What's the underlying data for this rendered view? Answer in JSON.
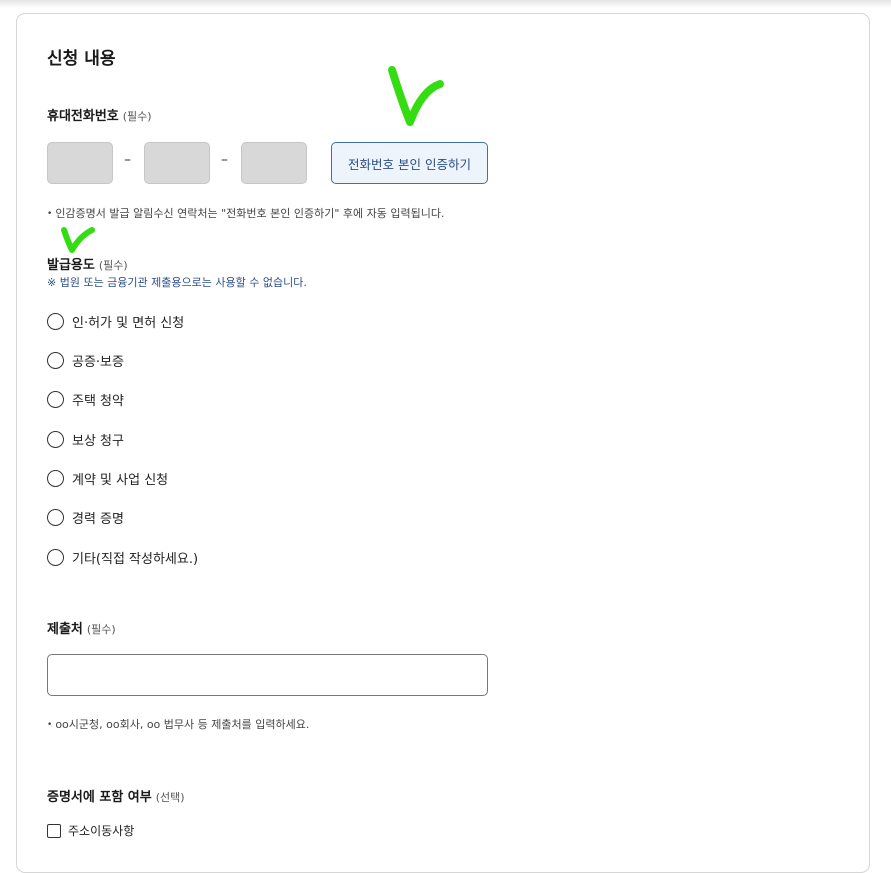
{
  "section": {
    "title": "신청 내용"
  },
  "phone": {
    "label": "휴대전화번호",
    "required": "(필수)",
    "dash": "–",
    "verify_label": "전화번호 본인 인증하기",
    "note": "인감증명서 발급 알림수신 연락처는 \"전화번호 본인 인증하기\" 후에 자동 입력됩니다."
  },
  "purpose": {
    "label": "발급용도",
    "required": "(필수)",
    "warning": "※ 법원 또는 금융기관 제출용으로는 사용할 수 없습니다.",
    "options": [
      "인·허가 및 면허 신청",
      "공증·보증",
      "주택 청약",
      "보상 청구",
      "계약 및 사업 신청",
      "경력 증명",
      "기타(직접 작성하세요.)"
    ]
  },
  "recipient": {
    "label": "제출처",
    "required": "(필수)",
    "value": "",
    "note": "oo시군청, oo회사, oo 법무사 등 제출처를 입력하세요."
  },
  "include": {
    "label": "증명서에 포함 여부",
    "optional": "(선택)",
    "option": "주소이동사항"
  },
  "annotations": {
    "check_color": "#33dd11"
  },
  "colors": {
    "accent": "#3f6fb0",
    "warning_text": "#2d4f8a"
  }
}
